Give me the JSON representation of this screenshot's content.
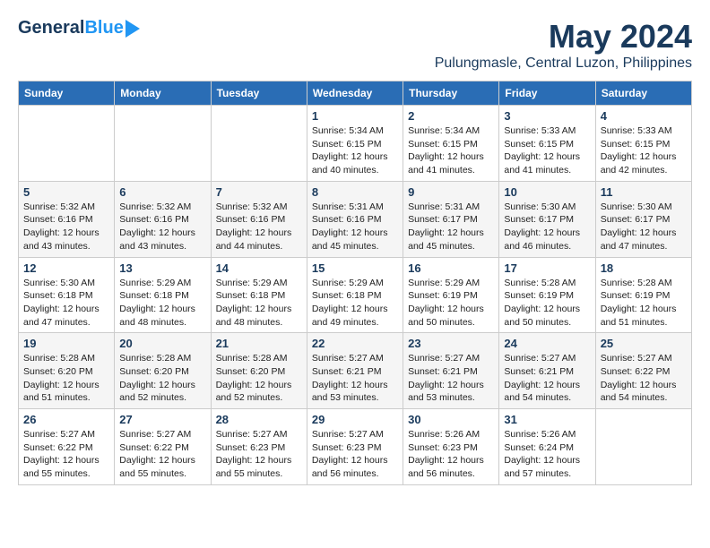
{
  "logo": {
    "general": "General",
    "blue": "Blue"
  },
  "title": "May 2024",
  "subtitle": "Pulungmasle, Central Luzon, Philippines",
  "days_of_week": [
    "Sunday",
    "Monday",
    "Tuesday",
    "Wednesday",
    "Thursday",
    "Friday",
    "Saturday"
  ],
  "weeks": [
    [
      {
        "day": "",
        "info": ""
      },
      {
        "day": "",
        "info": ""
      },
      {
        "day": "",
        "info": ""
      },
      {
        "day": "1",
        "info": "Sunrise: 5:34 AM\nSunset: 6:15 PM\nDaylight: 12 hours\nand 40 minutes."
      },
      {
        "day": "2",
        "info": "Sunrise: 5:34 AM\nSunset: 6:15 PM\nDaylight: 12 hours\nand 41 minutes."
      },
      {
        "day": "3",
        "info": "Sunrise: 5:33 AM\nSunset: 6:15 PM\nDaylight: 12 hours\nand 41 minutes."
      },
      {
        "day": "4",
        "info": "Sunrise: 5:33 AM\nSunset: 6:15 PM\nDaylight: 12 hours\nand 42 minutes."
      }
    ],
    [
      {
        "day": "5",
        "info": "Sunrise: 5:32 AM\nSunset: 6:16 PM\nDaylight: 12 hours\nand 43 minutes."
      },
      {
        "day": "6",
        "info": "Sunrise: 5:32 AM\nSunset: 6:16 PM\nDaylight: 12 hours\nand 43 minutes."
      },
      {
        "day": "7",
        "info": "Sunrise: 5:32 AM\nSunset: 6:16 PM\nDaylight: 12 hours\nand 44 minutes."
      },
      {
        "day": "8",
        "info": "Sunrise: 5:31 AM\nSunset: 6:16 PM\nDaylight: 12 hours\nand 45 minutes."
      },
      {
        "day": "9",
        "info": "Sunrise: 5:31 AM\nSunset: 6:17 PM\nDaylight: 12 hours\nand 45 minutes."
      },
      {
        "day": "10",
        "info": "Sunrise: 5:30 AM\nSunset: 6:17 PM\nDaylight: 12 hours\nand 46 minutes."
      },
      {
        "day": "11",
        "info": "Sunrise: 5:30 AM\nSunset: 6:17 PM\nDaylight: 12 hours\nand 47 minutes."
      }
    ],
    [
      {
        "day": "12",
        "info": "Sunrise: 5:30 AM\nSunset: 6:18 PM\nDaylight: 12 hours\nand 47 minutes."
      },
      {
        "day": "13",
        "info": "Sunrise: 5:29 AM\nSunset: 6:18 PM\nDaylight: 12 hours\nand 48 minutes."
      },
      {
        "day": "14",
        "info": "Sunrise: 5:29 AM\nSunset: 6:18 PM\nDaylight: 12 hours\nand 48 minutes."
      },
      {
        "day": "15",
        "info": "Sunrise: 5:29 AM\nSunset: 6:18 PM\nDaylight: 12 hours\nand 49 minutes."
      },
      {
        "day": "16",
        "info": "Sunrise: 5:29 AM\nSunset: 6:19 PM\nDaylight: 12 hours\nand 50 minutes."
      },
      {
        "day": "17",
        "info": "Sunrise: 5:28 AM\nSunset: 6:19 PM\nDaylight: 12 hours\nand 50 minutes."
      },
      {
        "day": "18",
        "info": "Sunrise: 5:28 AM\nSunset: 6:19 PM\nDaylight: 12 hours\nand 51 minutes."
      }
    ],
    [
      {
        "day": "19",
        "info": "Sunrise: 5:28 AM\nSunset: 6:20 PM\nDaylight: 12 hours\nand 51 minutes."
      },
      {
        "day": "20",
        "info": "Sunrise: 5:28 AM\nSunset: 6:20 PM\nDaylight: 12 hours\nand 52 minutes."
      },
      {
        "day": "21",
        "info": "Sunrise: 5:28 AM\nSunset: 6:20 PM\nDaylight: 12 hours\nand 52 minutes."
      },
      {
        "day": "22",
        "info": "Sunrise: 5:27 AM\nSunset: 6:21 PM\nDaylight: 12 hours\nand 53 minutes."
      },
      {
        "day": "23",
        "info": "Sunrise: 5:27 AM\nSunset: 6:21 PM\nDaylight: 12 hours\nand 53 minutes."
      },
      {
        "day": "24",
        "info": "Sunrise: 5:27 AM\nSunset: 6:21 PM\nDaylight: 12 hours\nand 54 minutes."
      },
      {
        "day": "25",
        "info": "Sunrise: 5:27 AM\nSunset: 6:22 PM\nDaylight: 12 hours\nand 54 minutes."
      }
    ],
    [
      {
        "day": "26",
        "info": "Sunrise: 5:27 AM\nSunset: 6:22 PM\nDaylight: 12 hours\nand 55 minutes."
      },
      {
        "day": "27",
        "info": "Sunrise: 5:27 AM\nSunset: 6:22 PM\nDaylight: 12 hours\nand 55 minutes."
      },
      {
        "day": "28",
        "info": "Sunrise: 5:27 AM\nSunset: 6:23 PM\nDaylight: 12 hours\nand 55 minutes."
      },
      {
        "day": "29",
        "info": "Sunrise: 5:27 AM\nSunset: 6:23 PM\nDaylight: 12 hours\nand 56 minutes."
      },
      {
        "day": "30",
        "info": "Sunrise: 5:26 AM\nSunset: 6:23 PM\nDaylight: 12 hours\nand 56 minutes."
      },
      {
        "day": "31",
        "info": "Sunrise: 5:26 AM\nSunset: 6:24 PM\nDaylight: 12 hours\nand 57 minutes."
      },
      {
        "day": "",
        "info": ""
      }
    ]
  ]
}
